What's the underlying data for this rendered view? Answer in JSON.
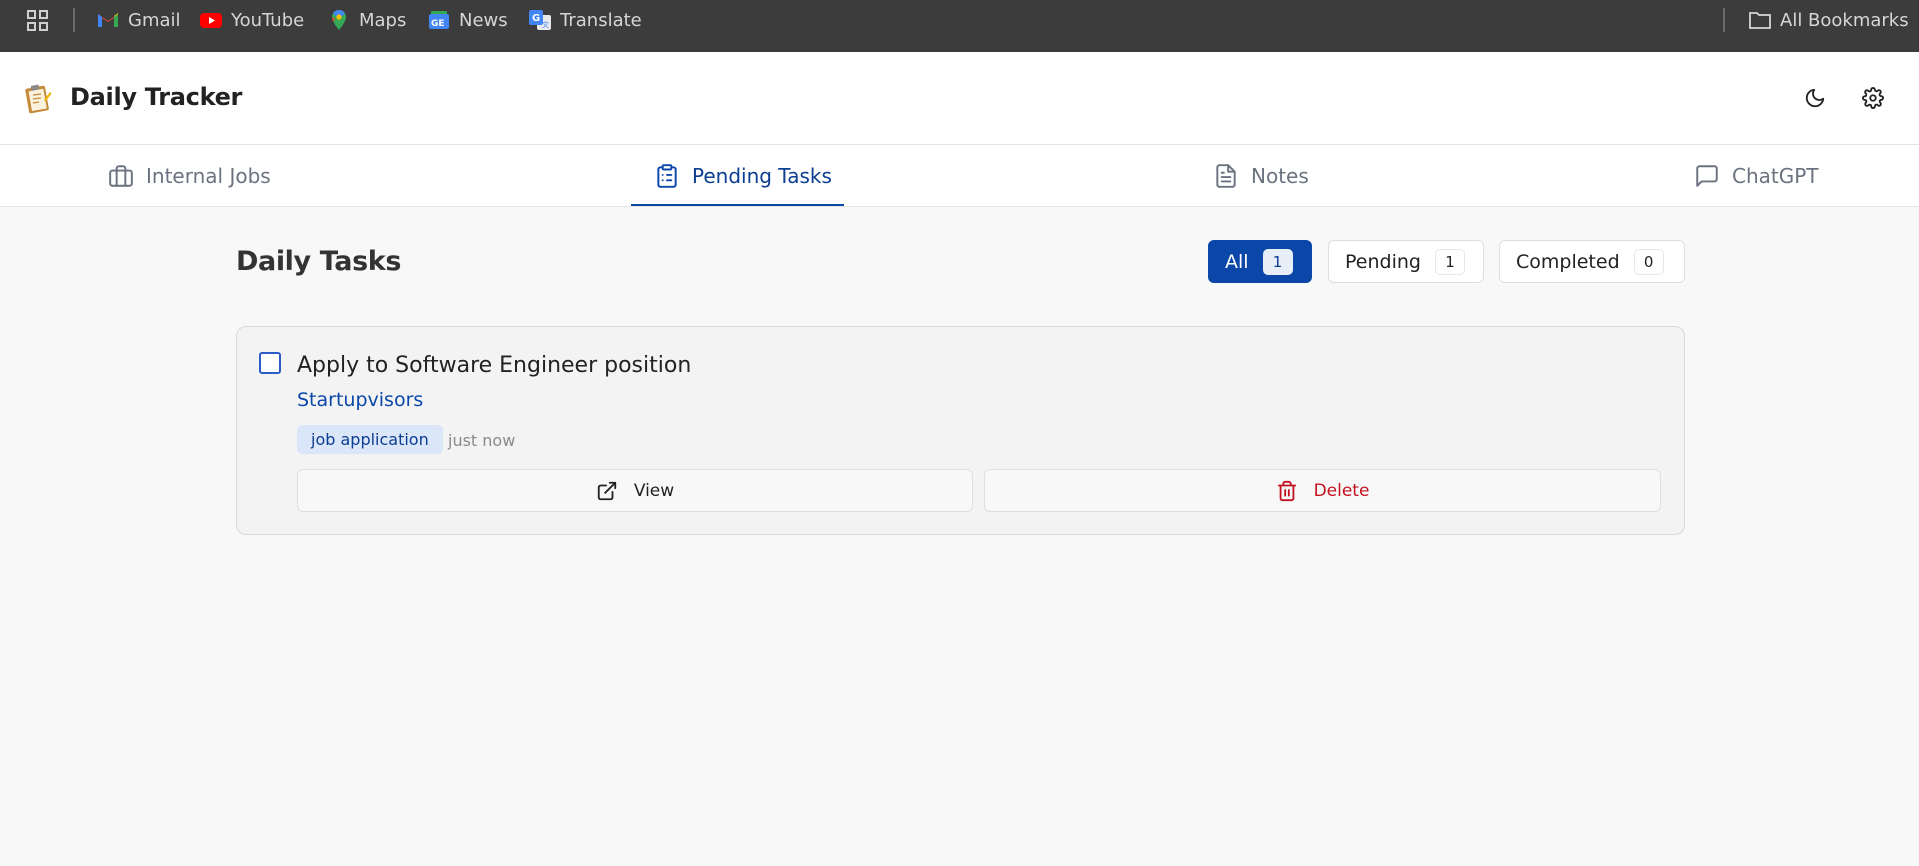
{
  "bookmarks": {
    "items": [
      {
        "label": "Gmail",
        "icon": "gmail-icon"
      },
      {
        "label": "YouTube",
        "icon": "youtube-icon"
      },
      {
        "label": "Maps",
        "icon": "maps-icon"
      },
      {
        "label": "News",
        "icon": "news-icon"
      },
      {
        "label": "Translate",
        "icon": "translate-icon"
      }
    ],
    "all_label": "All Bookmarks"
  },
  "header": {
    "title": "Daily Tracker"
  },
  "tabs": [
    {
      "label": "Internal Jobs",
      "icon": "briefcase-icon"
    },
    {
      "label": "Pending Tasks",
      "icon": "clipboard-icon",
      "active": true
    },
    {
      "label": "Notes",
      "icon": "document-icon"
    },
    {
      "label": "ChatGPT",
      "icon": "chat-icon"
    }
  ],
  "main": {
    "title": "Daily Tasks",
    "filters": [
      {
        "label": "All",
        "count": "1",
        "active": true
      },
      {
        "label": "Pending",
        "count": "1"
      },
      {
        "label": "Completed",
        "count": "0"
      }
    ],
    "tasks": [
      {
        "title": "Apply to Software Engineer position",
        "company": "Startupvisors",
        "tag": "job application",
        "time": "just now",
        "view_label": "View",
        "delete_label": "Delete"
      }
    ]
  },
  "colors": {
    "accent": "#0b47a8",
    "danger": "#c1121f",
    "bookmark_bar": "#3c3c3c"
  }
}
